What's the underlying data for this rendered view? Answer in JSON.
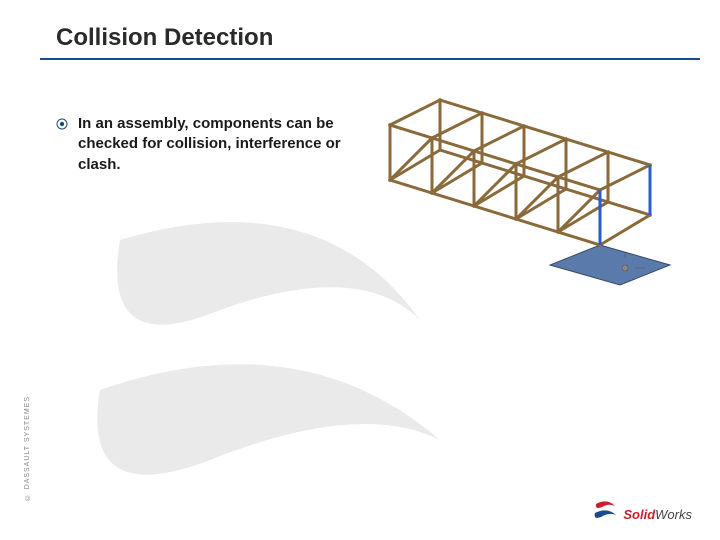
{
  "title": "Collision Detection",
  "bullet": "In an assembly, components can be checked for collision, interference or clash.",
  "side_label": "© DASSAULT SYSTEMES",
  "logo": {
    "brand_left": "Solid",
    "brand_right": "Works"
  }
}
